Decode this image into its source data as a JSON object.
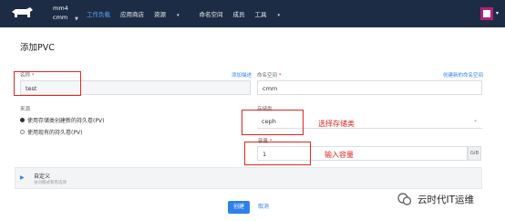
{
  "topbar": {
    "env_line1": "mm4",
    "env_line2": "cmm",
    "nav": [
      {
        "label": "工作负载",
        "active": true,
        "dropdown": false
      },
      {
        "label": "应用商店",
        "active": false,
        "dropdown": false
      },
      {
        "label": "资源",
        "active": false,
        "dropdown": true
      },
      {
        "label": "命名空间",
        "active": false,
        "dropdown": false
      },
      {
        "label": "成员",
        "active": false,
        "dropdown": false
      },
      {
        "label": "工具",
        "active": false,
        "dropdown": true
      }
    ]
  },
  "page": {
    "title": "添加PVC"
  },
  "form": {
    "name_label": "名称",
    "name_value": "test",
    "add_desc_link": "添加描述",
    "namespace_label": "命名空间",
    "namespace_value": "cmm",
    "create_ns_link": "创建新的命名空间",
    "source_label": "来源",
    "source_options": [
      {
        "label": "使用存储类创建新的持久卷(PV)",
        "selected": true
      },
      {
        "label": "使用现有的持久卷(PV)",
        "selected": false
      }
    ],
    "storage_class_label": "存储类",
    "storage_class_value": "ceph",
    "capacity_label": "容量",
    "capacity_value": "1",
    "capacity_unit": "GiB",
    "custom_title": "自定义",
    "custom_subtitle": "访问模式和卷选项"
  },
  "annotations": {
    "storage_class": "选择存储类",
    "capacity": "输入容量"
  },
  "actions": {
    "create": "创建",
    "cancel": "取消"
  },
  "watermark": "云时代IT运维",
  "colors": {
    "topbar": "#1d2c45",
    "accent": "#2f80ed",
    "annotation_red": "#e0261f"
  }
}
